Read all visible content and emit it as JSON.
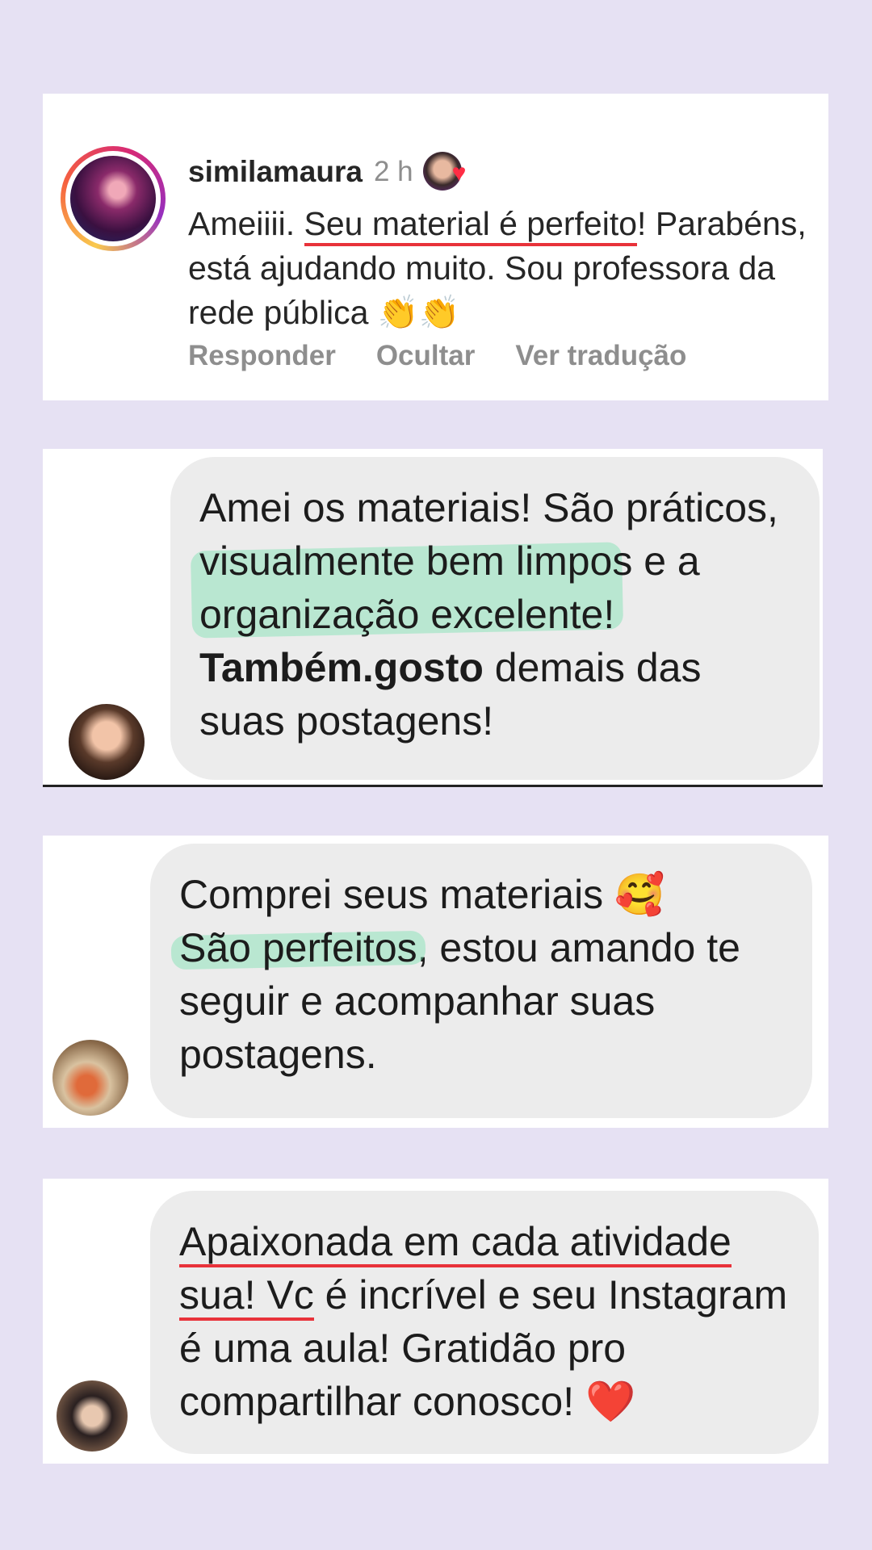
{
  "colors": {
    "background": "#e6e1f3",
    "underline": "#e8323a",
    "highlight": "#6ee1aa",
    "bubble": "#ececec"
  },
  "comment": {
    "username": "similamaura",
    "time": "2 h",
    "liked_icon": "heart-icon",
    "text_before": "Ameiiii. ",
    "text_underlined": "Seu material é perfeito",
    "text_after": "! Parabéns, está ajudando muito. Sou professora da rede pública",
    "emoji": "👏👏",
    "actions": [
      "Responder",
      "Ocultar",
      "Ver tradução"
    ]
  },
  "message2": {
    "p1": "Amei os materiais! São práticos,",
    "highlight": "visualmente bem limpos e a organização excelente!",
    "bold": "Também.gosto",
    "p2": "demais das suas postagens!"
  },
  "message3": {
    "p1": "Comprei seus materiais",
    "emoji": "🥰",
    "highlight": "São perfeitos",
    "p2": ", estou amando te seguir e acompanhar suas postagens."
  },
  "message4": {
    "underlined": "Apaixonada em cada atividade sua! Vc",
    "p1": " é incrível e seu Instagram é uma aula! Gratidão pro compartilhar conosco!",
    "emoji": "❤️"
  }
}
